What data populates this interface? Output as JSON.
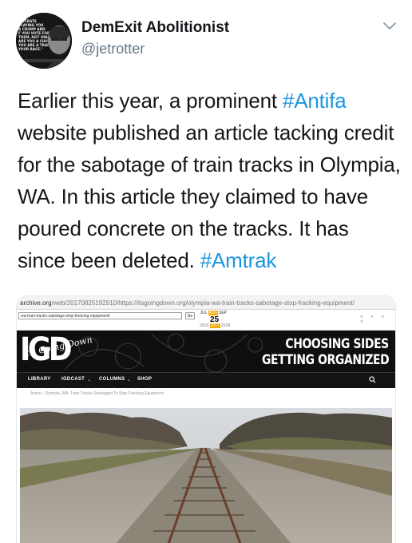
{
  "tweet": {
    "display_name": "DemExit Abolitionist",
    "handle": "@jetrotter",
    "text_segments": [
      {
        "text": "Earlier this year, a prominent ",
        "type": "text"
      },
      {
        "text": "#Antifa",
        "type": "hashtag"
      },
      {
        "text": " website published an article tacking credit for the sabotage of train tracks in Olympia, WA. In this article they claimed to have poured concrete on the tracks. It has since been deleted. ",
        "type": "text"
      },
      {
        "text": "#Amtrak",
        "type": "hashtag"
      }
    ],
    "avatar_text": [
      "MOCRATS",
      "PLAYING YOU",
      "A CHUMP AND",
      "F YOU VOTE FOR",
      "THEM, NOT ONLY",
      "ARE YOU A CHUMP,",
      "YOU ARE A TRAITOR",
      "YOUR RACE.\""
    ],
    "colors": {
      "hashtag": "#1b95e0",
      "handle": "#657786",
      "text": "#14171a"
    },
    "icons": {
      "menu": "chevron-down-icon"
    }
  },
  "screenshot": {
    "wayback_prefix": "archive.org",
    "wayback_rest": "/web/20170825192910/https://itsgoingdown.org/olympia-wa-train-tracks-sabotage-stop-fracking-equipment/",
    "wayback_url_field": "wa-train-tracks-sabotage-stop-fracking-equipment/",
    "wayback_go": "Go",
    "cal_months": [
      "JUL",
      "AUG",
      "SEP"
    ],
    "cal_day": "25",
    "cal_years": [
      "2016",
      "2017",
      "2018"
    ],
    "logo": "IGD",
    "logo_script": "It's Going Down",
    "slogan_line1": "CHOOSING SIDES",
    "slogan_line2": "GETTING ORGANIZED",
    "nav": [
      "LIBRARY",
      "IGDCAST",
      "COLUMNS",
      "SHOP"
    ],
    "breadcrumb": "Action  ›  Olympia, WA: Train Tracks Sabotaged To Stop Fracking Equipment",
    "accent_color": "#f2a900"
  }
}
